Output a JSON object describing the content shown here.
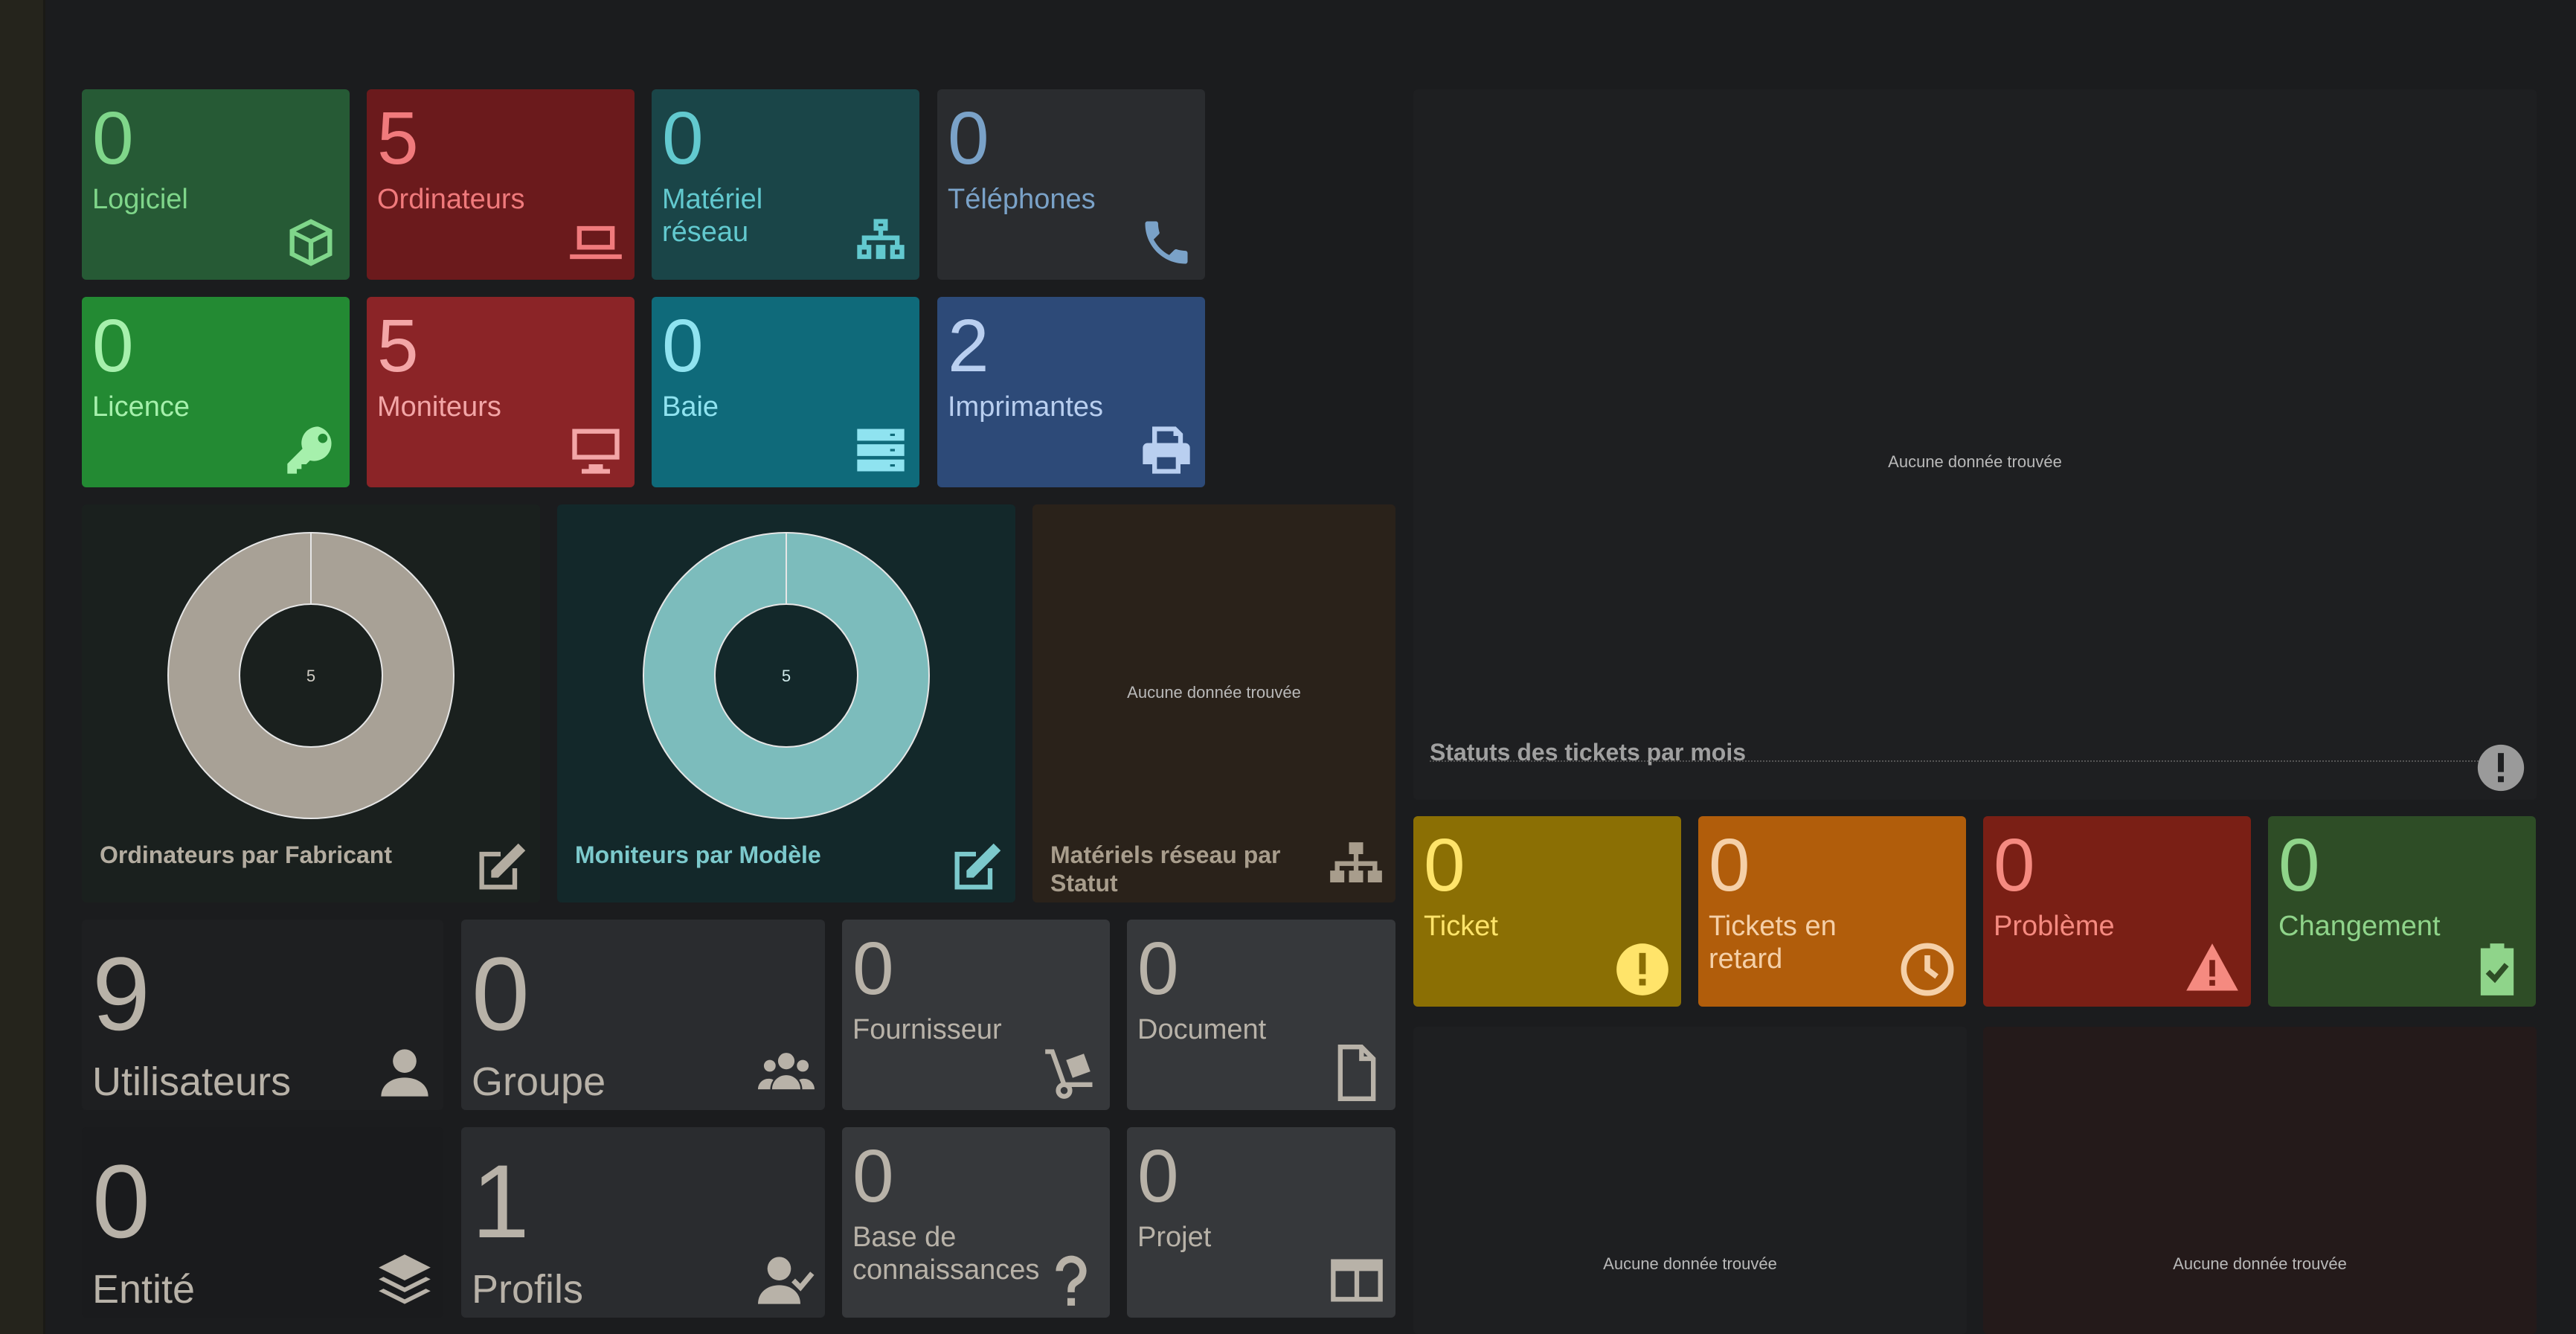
{
  "assets": {
    "software": {
      "count": "0",
      "label": "Logiciel"
    },
    "computers": {
      "count": "5",
      "label": "Ordinateurs"
    },
    "network": {
      "count": "0",
      "label": "Matériel réseau"
    },
    "phones": {
      "count": "0",
      "label": "Téléphones"
    },
    "licenses": {
      "count": "0",
      "label": "Licence"
    },
    "monitors": {
      "count": "5",
      "label": "Moniteurs"
    },
    "racks": {
      "count": "0",
      "label": "Baie"
    },
    "printers": {
      "count": "2",
      "label": "Imprimantes"
    }
  },
  "charts": {
    "computers_by_manufacturer": {
      "title": "Ordinateurs par Fabricant",
      "center_value": "5",
      "icon": "edit-icon"
    },
    "monitors_by_model": {
      "title": "Moniteurs par Modèle",
      "center_value": "5",
      "icon": "edit-icon"
    },
    "network_by_status": {
      "title": "Matériels réseau par Statut",
      "no_data": "Aucune donnée trouvée",
      "icon": "sitemap-icon"
    },
    "tickets_by_month": {
      "title": "Statuts des tickets par mois",
      "no_data": "Aucune donnée trouvée",
      "icon": "exclamation-icon"
    },
    "bottom_left": {
      "no_data": "Aucune donnée trouvée"
    },
    "bottom_right": {
      "no_data": "Aucune donnée trouvée"
    }
  },
  "chart_data": [
    {
      "type": "pie",
      "title": "Ordinateurs par Fabricant",
      "total": 5,
      "slices": [
        {
          "value": 5,
          "color": "#a8a196"
        }
      ]
    },
    {
      "type": "pie",
      "title": "Moniteurs par Modèle",
      "total": 5,
      "slices": [
        {
          "value": 5,
          "color": "#7cbcbc"
        }
      ]
    }
  ],
  "admin": {
    "users": {
      "count": "9",
      "label": "Utilisateurs"
    },
    "groups": {
      "count": "0",
      "label": "Groupe"
    },
    "suppliers": {
      "count": "0",
      "label": "Fournisseur"
    },
    "documents": {
      "count": "0",
      "label": "Document"
    },
    "entities": {
      "count": "0",
      "label": "Entité"
    },
    "profiles": {
      "count": "1",
      "label": "Profils"
    },
    "knowledge": {
      "count": "0",
      "label": "Base de connaissances"
    },
    "projects": {
      "count": "0",
      "label": "Projet"
    }
  },
  "itil": {
    "tickets": {
      "count": "0",
      "label": "Ticket"
    },
    "late": {
      "count": "0",
      "label": "Tickets en retard"
    },
    "problems": {
      "count": "0",
      "label": "Problème"
    },
    "changes": {
      "count": "0",
      "label": "Changement"
    }
  },
  "colors": {
    "software": "#265a35",
    "computers": "#6b1a1c",
    "network": "#1a4548",
    "phones": "#2a2c2f",
    "licenses": "#238a33",
    "monitors": "#8b2427",
    "racks": "#0f6a7a",
    "printers": "#2d4a78",
    "ticket": "#8b6f04",
    "late": "#b15d0b",
    "problem": "#7a1f15",
    "change": "#2e4d26"
  }
}
